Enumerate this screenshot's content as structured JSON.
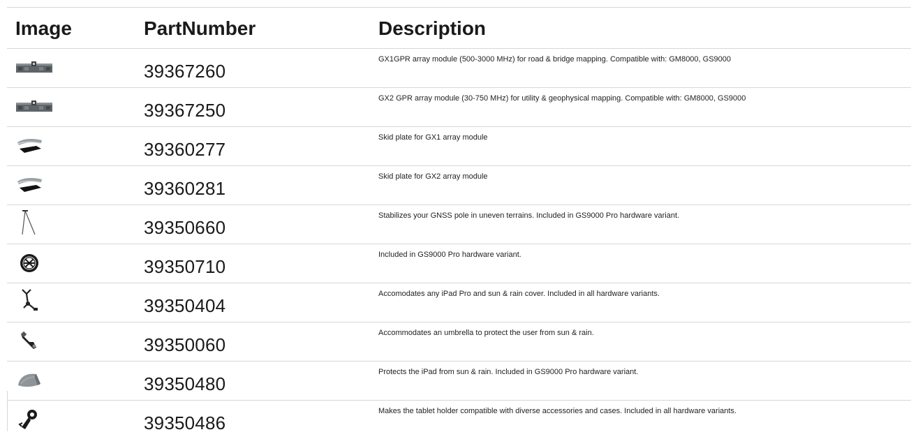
{
  "header": {
    "image": "Image",
    "part_number": "PartNumber",
    "description": "Description"
  },
  "rows": [
    {
      "icon": "gpr-array-module-icon",
      "part_number": "39367260",
      "description": "GX1GPR array module (500-3000 MHz) for road & bridge mapping. Compatible with: GM8000, GS9000"
    },
    {
      "icon": "gpr-array-module-icon",
      "part_number": "39367250",
      "description": "GX2 GPR array module (30-750 MHz) for utility & geophysical mapping. Compatible with: GM8000, GS9000"
    },
    {
      "icon": "skid-plate-icon",
      "part_number": "39360277",
      "description": "Skid plate for GX1 array module"
    },
    {
      "icon": "skid-plate-icon",
      "part_number": "39360281",
      "description": "Skid plate for GX2 array module"
    },
    {
      "icon": "pole-stabilizer-icon",
      "part_number": "39350660",
      "description": "Stabilizes your GNSS pole in uneven terrains. Included in GS9000 Pro hardware variant."
    },
    {
      "icon": "wheel-icon",
      "part_number": "39350710",
      "description": "Included in GS9000 Pro hardware variant."
    },
    {
      "icon": "ipad-holder-icon",
      "part_number": "39350404",
      "description": "Accomodates any iPad Pro and sun & rain cover. Included in all hardware variants."
    },
    {
      "icon": "umbrella-holder-icon",
      "part_number": "39350060",
      "description": "Accommodates an umbrella to protect the user from sun & rain."
    },
    {
      "icon": "ipad-cover-icon",
      "part_number": "39350480",
      "description": "Protects the iPad from sun & rain. Included in GS9000 Pro hardware variant."
    },
    {
      "icon": "tablet-adapter-icon",
      "part_number": "39350486",
      "description": "Makes the tablet holder compatible with diverse accessories and cases. Included in all hardware variants."
    }
  ]
}
